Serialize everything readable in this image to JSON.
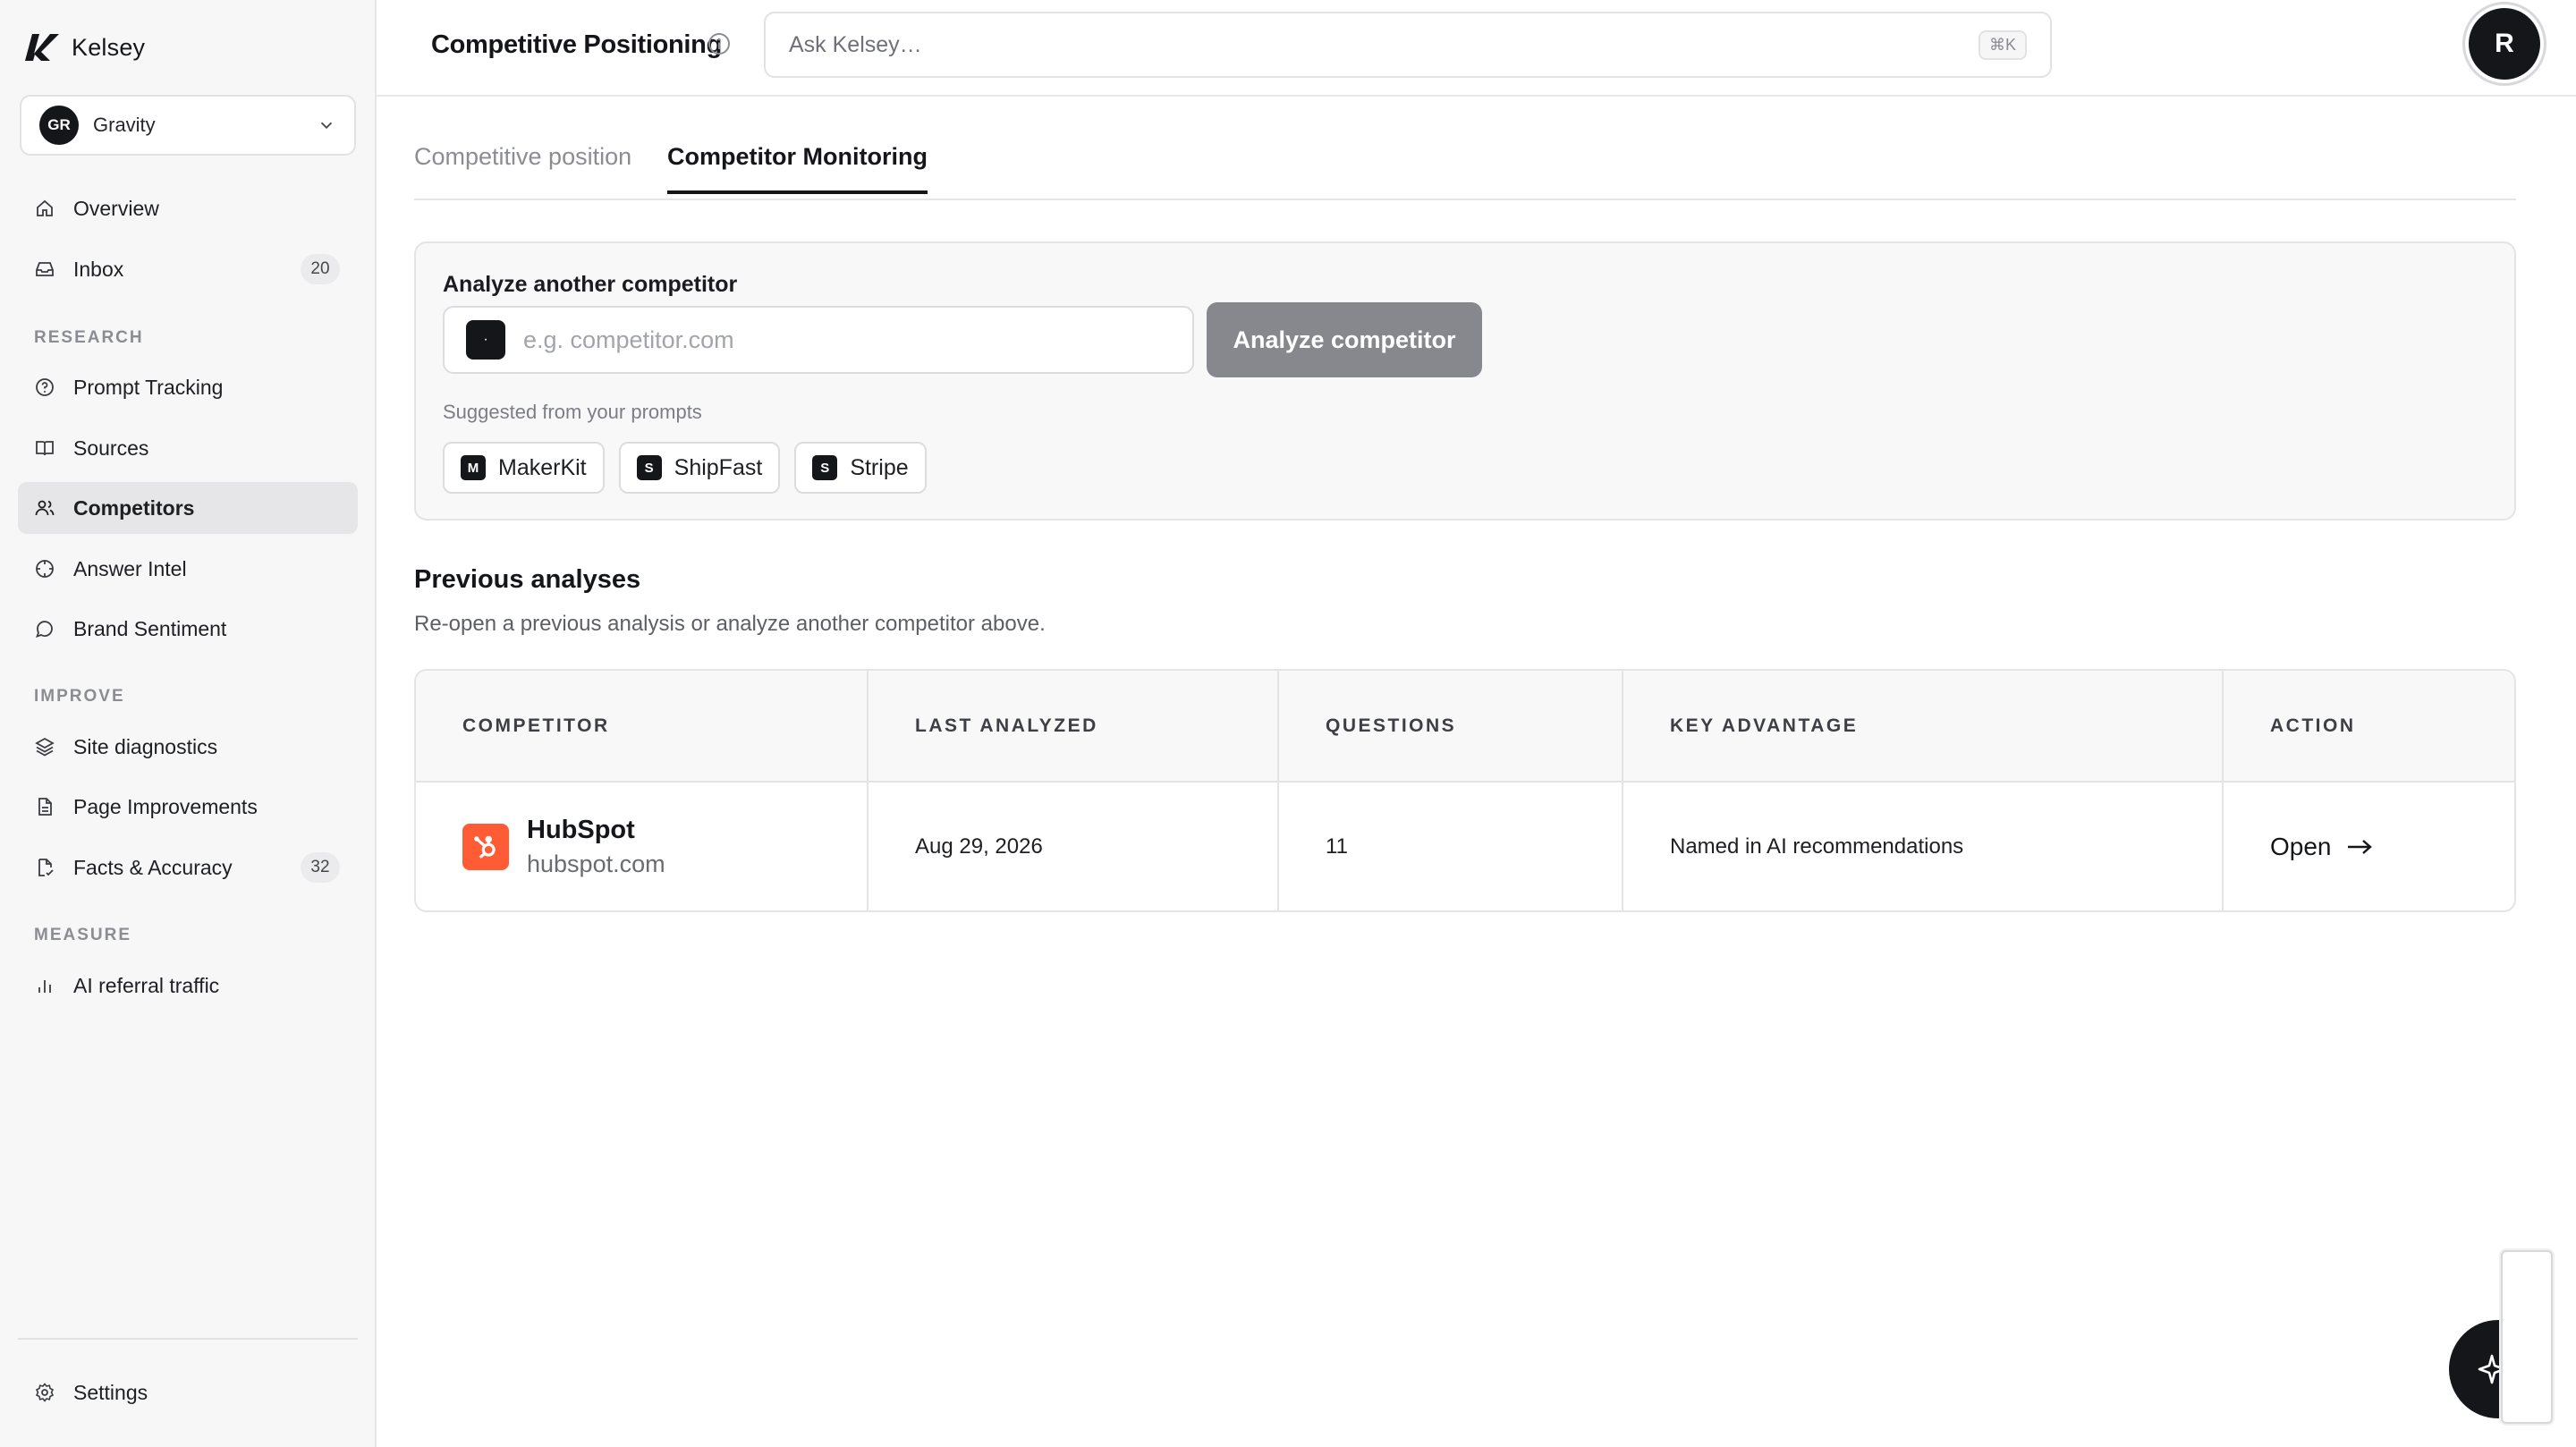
{
  "brand": {
    "name": "Kelsey"
  },
  "workspace": {
    "initials": "GR",
    "name": "Gravity"
  },
  "nav": {
    "overview": "Overview",
    "inbox": {
      "label": "Inbox",
      "count": "20"
    },
    "research_heading": "RESEARCH",
    "prompt_tracking": "Prompt Tracking",
    "sources": "Sources",
    "competitors": "Competitors",
    "answer_intel": "Answer Intel",
    "brand_sentiment": "Brand Sentiment",
    "improve_heading": "IMPROVE",
    "site_diagnostics": "Site diagnostics",
    "page_improvements": "Page Improvements",
    "facts": {
      "label": "Facts & Accuracy",
      "count": "32"
    },
    "measure_heading": "MEASURE",
    "ai_referral": "AI referral traffic",
    "settings": "Settings"
  },
  "header": {
    "title": "Competitive Positioning",
    "search_placeholder": "Ask Kelsey…",
    "shortcut": "⌘K",
    "user_initial": "R"
  },
  "tabs": [
    {
      "label": "Competitive position",
      "active": false
    },
    {
      "label": "Competitor Monitoring",
      "active": true
    }
  ],
  "analyze": {
    "label": "Analyze another competitor",
    "placeholder": "e.g. competitor.com",
    "button": "Analyze competitor",
    "suggest_label": "Suggested from your prompts",
    "suggestions": [
      {
        "initial": "M",
        "name": "MakerKit"
      },
      {
        "initial": "S",
        "name": "ShipFast"
      },
      {
        "initial": "S",
        "name": "Stripe"
      }
    ]
  },
  "previous": {
    "title": "Previous analyses",
    "subtitle": "Re-open a previous analysis or analyze another competitor above.",
    "columns": [
      "COMPETITOR",
      "LAST ANALYZED",
      "QUESTIONS",
      "KEY ADVANTAGE",
      "ACTION"
    ],
    "rows": [
      {
        "name": "HubSpot",
        "domain": "hubspot.com",
        "last_analyzed": "Aug 29, 2026",
        "questions": "11",
        "key_advantage": "Named in AI recommendations",
        "action": "Open"
      }
    ]
  },
  "colors": {
    "accent": "#15161a",
    "hubspot": "#ff5c35",
    "button_disabled": "#86888e"
  },
  "icons": [
    "home-icon",
    "inbox-icon",
    "help-circle-icon",
    "book-icon",
    "users-icon",
    "crosshair-icon",
    "message-icon",
    "layers-icon",
    "document-icon",
    "document-check-icon",
    "bar-chart-icon",
    "gear-icon",
    "info-icon",
    "chevron-down-icon",
    "arrow-right-icon",
    "sparkle-icon"
  ]
}
